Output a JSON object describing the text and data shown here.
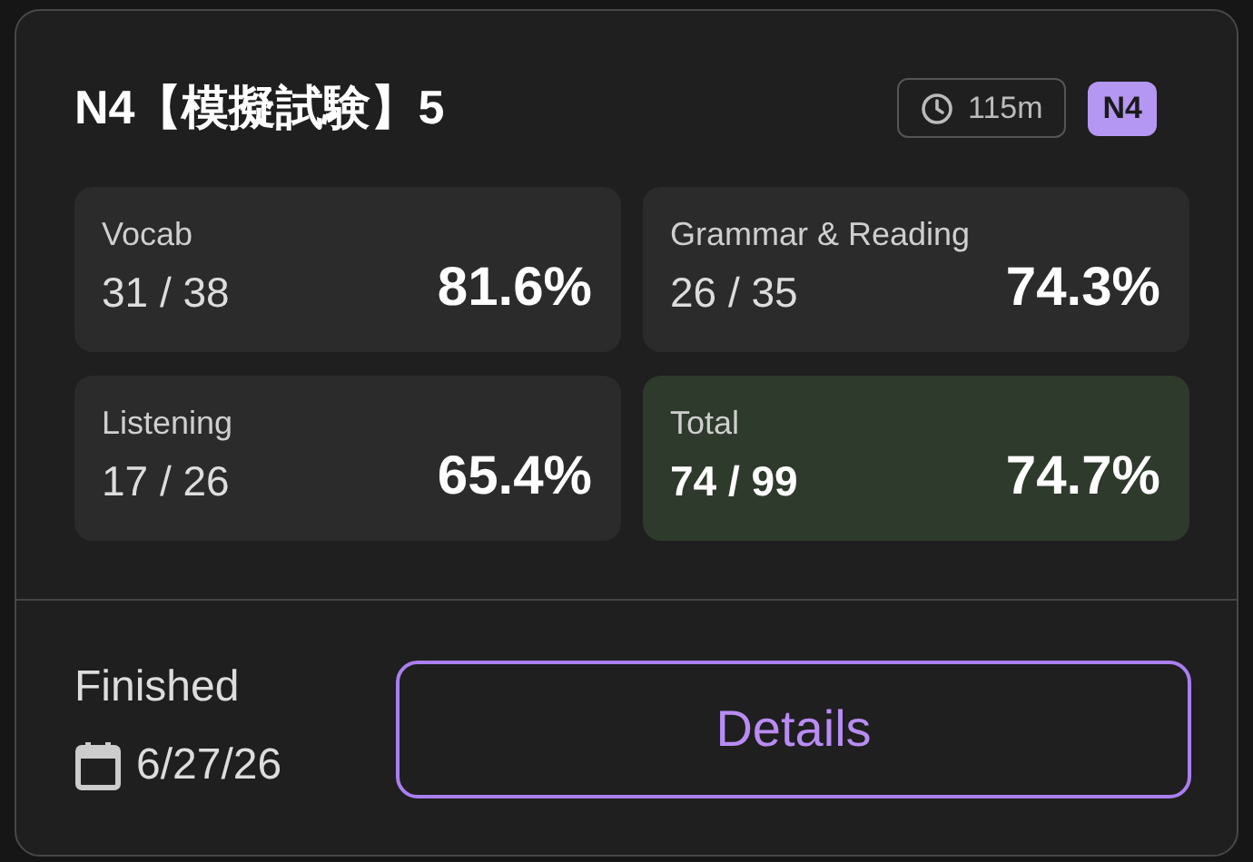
{
  "title": "N4【模擬試験】5",
  "duration": "115m",
  "level_badge": "N4",
  "sections": [
    {
      "kind": "section",
      "label": "Vocab",
      "score": "31 / 38",
      "percent": "81.6%"
    },
    {
      "kind": "section",
      "label": "Grammar & Reading",
      "score": "26 / 35",
      "percent": "74.3%"
    },
    {
      "kind": "section",
      "label": "Listening",
      "score": "17 / 26",
      "percent": "65.4%"
    },
    {
      "kind": "total",
      "label": "Total",
      "score": "74 / 99",
      "percent": "74.7%"
    }
  ],
  "status": "Finished",
  "date": "6/27/26",
  "button": "Details"
}
